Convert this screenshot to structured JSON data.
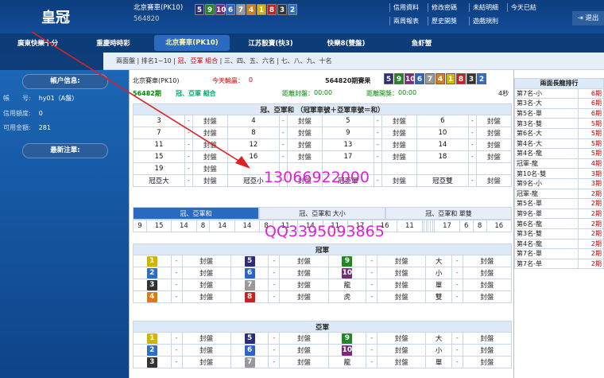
{
  "header": {
    "logo": "皇冠",
    "game": "北京賽車(PK10)",
    "period": "564820",
    "balls": [
      {
        "n": "5",
        "c": "#2c2c7a"
      },
      {
        "n": "9",
        "c": "#228822"
      },
      {
        "n": "10",
        "c": "#7a2a7a"
      },
      {
        "n": "6",
        "c": "#2c63c9"
      },
      {
        "n": "7",
        "c": "#999999"
      },
      {
        "n": "4",
        "c": "#e07a10"
      },
      {
        "n": "1",
        "c": "#d4b400"
      },
      {
        "n": "8",
        "c": "#cc2020"
      },
      {
        "n": "3",
        "c": "#333333"
      },
      {
        "n": "2",
        "c": "#2a6fc9"
      }
    ],
    "links": [
      "信用資料",
      "修改密碼",
      "未結明細",
      "今天已結",
      "兩周報表",
      "歷史開獎",
      "遊戲規則"
    ],
    "exit": "退出"
  },
  "nav": [
    "廣東快樂十分",
    "重慶時時彩",
    "北京賽車(PK10)",
    "江苏骰寶(快3)",
    "快樂8(雙盤)",
    "鱼虾蟹"
  ],
  "subnav": {
    "a": "兩面盤 | 排名1~10 | ",
    "b": "冠、亞軍 組合",
    "c": " | 三、四、五、六名 | 七、八、九、十名"
  },
  "side": {
    "acct_title": "帳户信息:",
    "rows": [
      {
        "k": "帳　　号:",
        "v": "hy01（A盤）"
      },
      {
        "k": "信用額度:",
        "v": "0"
      },
      {
        "k": "可用金額:",
        "v": "281"
      }
    ],
    "latest": "最新注單:"
  },
  "main": {
    "game": "北京賽車(PK10)",
    "today_label": "今天輸贏：",
    "today_val": "0",
    "period": "564820期賽果",
    "balls": [
      {
        "n": "5",
        "c": "#2c2c7a"
      },
      {
        "n": "9",
        "c": "#228822"
      },
      {
        "n": "10",
        "c": "#7a2a7a"
      },
      {
        "n": "6",
        "c": "#2c63c9"
      },
      {
        "n": "7",
        "c": "#999999"
      },
      {
        "n": "4",
        "c": "#e07a10"
      },
      {
        "n": "1",
        "c": "#d4b400"
      },
      {
        "n": "8",
        "c": "#cc2020"
      },
      {
        "n": "3",
        "c": "#333333"
      },
      {
        "n": "2",
        "c": "#2a6fc9"
      }
    ],
    "cur": "56482",
    "cur_suffix": "期",
    "combo": "冠、亞軍 組合",
    "close_label": "距離封盤：",
    "close_val": "00:00",
    "draw_label": "距離開獎：",
    "draw_val": "00:00",
    "secs": "4秒",
    "sum_title": "冠、亞軍和 （冠軍車號＋亞軍車號＝和）",
    "sum_rows": [
      [
        "3",
        "-",
        "封盤",
        "4",
        "-",
        "封盤",
        "5",
        "-",
        "封盤",
        "6",
        "-",
        "封盤"
      ],
      [
        "7",
        "-",
        "封盤",
        "8",
        "-",
        "封盤",
        "9",
        "-",
        "封盤",
        "10",
        "-",
        "封盤"
      ],
      [
        "11",
        "-",
        "封盤",
        "12",
        "-",
        "封盤",
        "13",
        "-",
        "封盤",
        "14",
        "-",
        "封盤"
      ],
      [
        "15",
        "-",
        "封盤",
        "16",
        "-",
        "封盤",
        "17",
        "-",
        "封盤",
        "18",
        "-",
        "封盤"
      ],
      [
        "19",
        "-",
        "封盤",
        "",
        "",
        "",
        "",
        "",
        "",
        "",
        "",
        ""
      ],
      [
        "冠亞大",
        "-",
        "封盤",
        "冠亞小",
        "-",
        "封盤",
        "冠亞單",
        "-",
        "封盤",
        "冠亞雙",
        "-",
        "封盤"
      ]
    ],
    "tabs": [
      "冠、亞軍和",
      "冠、亞軍和 大小",
      "冠、亞軍和 單雙"
    ],
    "hist": [
      "9",
      "15",
      "14",
      "8",
      "14",
      "14",
      "8",
      "11",
      "14",
      "11",
      "17",
      "16",
      "11",
      "",
      "",
      "",
      "",
      "",
      "",
      "17",
      "6",
      "8",
      "16"
    ],
    "champ_title": "冠軍",
    "runner_title": "亞軍",
    "champ_rows": [
      [
        {
          "n": "1",
          "c": "#d4b400"
        },
        "封盤",
        {
          "n": "5",
          "c": "#2c2c7a"
        },
        "封盤",
        {
          "n": "9",
          "c": "#228822"
        },
        "封盤",
        "大",
        "封盤"
      ],
      [
        {
          "n": "2",
          "c": "#2a6fc9"
        },
        "封盤",
        {
          "n": "6",
          "c": "#2c63c9"
        },
        "封盤",
        {
          "n": "10",
          "c": "#7a2a7a"
        },
        "封盤",
        "小",
        "封盤"
      ],
      [
        {
          "n": "3",
          "c": "#333333"
        },
        "封盤",
        {
          "n": "7",
          "c": "#999999"
        },
        "封盤",
        "龍",
        "封盤",
        "單",
        "封盤"
      ],
      [
        {
          "n": "4",
          "c": "#e07a10"
        },
        "封盤",
        {
          "n": "8",
          "c": "#cc2020"
        },
        "封盤",
        "虎",
        "封盤",
        "雙",
        "封盤"
      ]
    ],
    "runner_rows": [
      [
        {
          "n": "1",
          "c": "#d4b400"
        },
        "封盤",
        {
          "n": "5",
          "c": "#2c2c7a"
        },
        "封盤",
        {
          "n": "9",
          "c": "#228822"
        },
        "封盤",
        "大",
        "封盤"
      ],
      [
        {
          "n": "2",
          "c": "#2a6fc9"
        },
        "封盤",
        {
          "n": "6",
          "c": "#2c63c9"
        },
        "封盤",
        {
          "n": "10",
          "c": "#7a2a7a"
        },
        "封盤",
        "小",
        "封盤"
      ],
      [
        {
          "n": "3",
          "c": "#333333"
        },
        "封盤",
        {
          "n": "7",
          "c": "#999999"
        },
        "封盤",
        "龍",
        "封盤",
        "單",
        "封盤"
      ]
    ]
  },
  "right": {
    "title": "兩面長龍排行",
    "rows": [
      [
        "第7名-小",
        "6期"
      ],
      [
        "第3名-大",
        "6期"
      ],
      [
        "第5名-單",
        "6期"
      ],
      [
        "第3名-雙",
        "5期"
      ],
      [
        "第6名-大",
        "5期"
      ],
      [
        "第4名-大",
        "5期"
      ],
      [
        "第4名-龍",
        "5期"
      ],
      [
        "冠軍-龍",
        "4期"
      ],
      [
        "第10名-雙",
        "3期"
      ],
      [
        "第9名-小",
        "3期"
      ],
      [
        "冠軍-龍",
        "2期"
      ],
      [
        "第5名-單",
        "2期"
      ],
      [
        "第9名-單",
        "2期"
      ],
      [
        "第6名-龍",
        "2期"
      ],
      [
        "第3名-雙",
        "2期"
      ],
      [
        "第4名-龍",
        "2期"
      ],
      [
        "第7名-單",
        "2期"
      ],
      [
        "第7名-单",
        "2期"
      ]
    ]
  },
  "watermark": {
    "phone": "13066922000",
    "qq": "QQ3395093865"
  }
}
